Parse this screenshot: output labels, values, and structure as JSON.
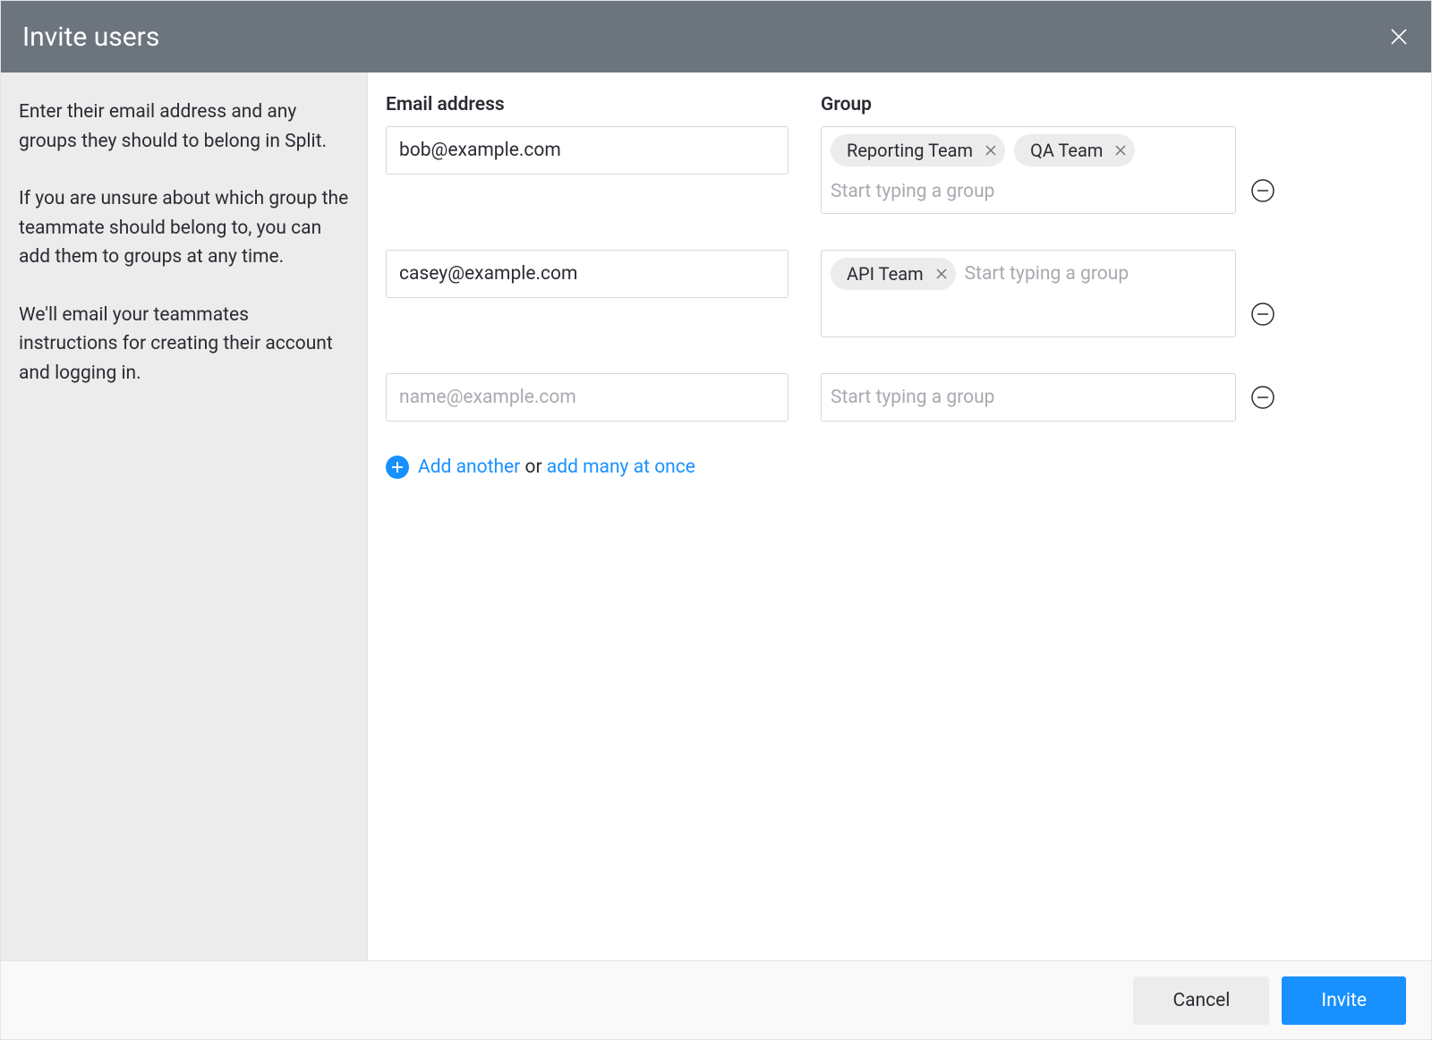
{
  "header": {
    "title": "Invite users"
  },
  "sidebar": {
    "para1": "Enter their email address and any groups they should to belong in Split.",
    "para2": "If you are unsure about which group the teammate should belong to, you can add them to groups at any time.",
    "para3": "We'll email your teammates instructions for creating their account and logging in."
  },
  "labels": {
    "email": "Email address",
    "group": "Group"
  },
  "rows": [
    {
      "email": "bob@example.com",
      "groups": [
        "Reporting Team",
        "QA Team"
      ]
    },
    {
      "email": "casey@example.com",
      "groups": [
        "API Team"
      ]
    },
    {
      "email": "",
      "groups": []
    }
  ],
  "placeholders": {
    "email": "name@example.com",
    "group": "Start typing a group"
  },
  "addRow": {
    "addAnother": "Add another",
    "or": " or ",
    "addMany": "add many at once"
  },
  "footer": {
    "cancel": "Cancel",
    "invite": "Invite"
  }
}
